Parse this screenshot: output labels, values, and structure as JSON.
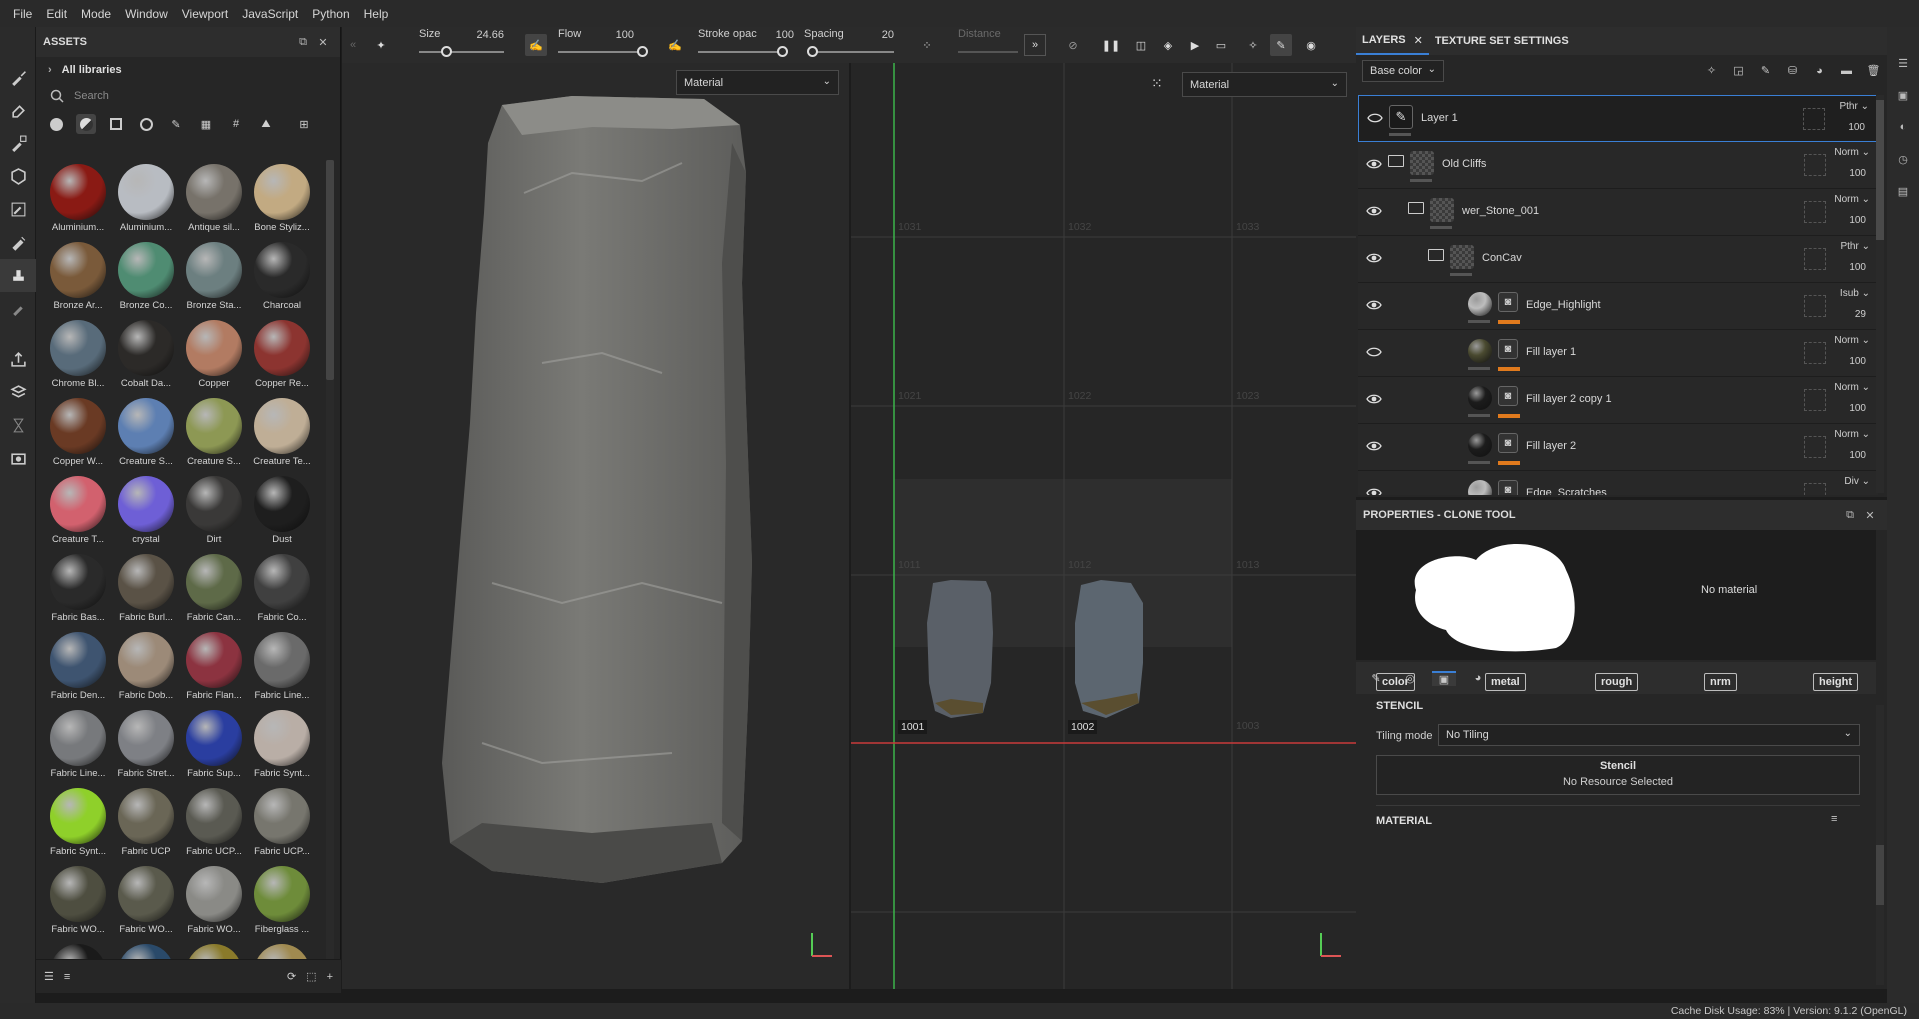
{
  "menu": [
    "File",
    "Edit",
    "Mode",
    "Window",
    "Viewport",
    "JavaScript",
    "Python",
    "Help"
  ],
  "assets": {
    "title": "ASSETS",
    "libraries": "All libraries",
    "search_placeholder": "Search",
    "materials": [
      {
        "label": "Aluminium...",
        "color": "#8a1a14"
      },
      {
        "label": "Aluminium...",
        "color": "#b8bcc2"
      },
      {
        "label": "Antique sil...",
        "color": "#77726a"
      },
      {
        "label": "Bone Styliz...",
        "color": "#c2aa82"
      },
      {
        "label": "Bronze Ar...",
        "color": "#7a5a3a"
      },
      {
        "label": "Bronze Co...",
        "color": "#4f8c72"
      },
      {
        "label": "Bronze Sta...",
        "color": "#6c7f80"
      },
      {
        "label": "Charcoal",
        "color": "#2a2a2a"
      },
      {
        "label": "Chrome Bl...",
        "color": "#586b7a"
      },
      {
        "label": "Cobalt Da...",
        "color": "#2c2a28"
      },
      {
        "label": "Copper",
        "color": "#b27b62"
      },
      {
        "label": "Copper Re...",
        "color": "#8c3430"
      },
      {
        "label": "Copper W...",
        "color": "#6a3a24"
      },
      {
        "label": "Creature S...",
        "color": "#5d7fb2"
      },
      {
        "label": "Creature S...",
        "color": "#8d9854"
      },
      {
        "label": "Creature Te...",
        "color": "#bfae96"
      },
      {
        "label": "Creature T...",
        "color": "#d2616e"
      },
      {
        "label": "crystal",
        "color": "#6e5fd6"
      },
      {
        "label": "Dirt",
        "color": "#3a3938"
      },
      {
        "label": "Dust",
        "color": "#1e1e1e"
      },
      {
        "label": "Fabric Bas...",
        "color": "#2a2a2a"
      },
      {
        "label": "Fabric Burl...",
        "color": "#5a5246"
      },
      {
        "label": "Fabric Can...",
        "color": "#5e6a48"
      },
      {
        "label": "Fabric Co...",
        "color": "#404040"
      },
      {
        "label": "Fabric Den...",
        "color": "#3e5470"
      },
      {
        "label": "Fabric Dob...",
        "color": "#9c8a78"
      },
      {
        "label": "Fabric Flan...",
        "color": "#8c3340"
      },
      {
        "label": "Fabric Line...",
        "color": "#6a6a6a"
      },
      {
        "label": "Fabric Line...",
        "color": "#77797c"
      },
      {
        "label": "Fabric Stret...",
        "color": "#7e8085"
      },
      {
        "label": "Fabric Sup...",
        "color": "#2a3ea0"
      },
      {
        "label": "Fabric Synt...",
        "color": "#b9aea6"
      },
      {
        "label": "Fabric Synt...",
        "color": "#8fd02a"
      },
      {
        "label": "Fabric UCP",
        "color": "#6a6656"
      },
      {
        "label": "Fabric UCP...",
        "color": "#5a5a52"
      },
      {
        "label": "Fabric UCP...",
        "color": "#77766e"
      },
      {
        "label": "Fabric WO...",
        "color": "#4e4e40"
      },
      {
        "label": "Fabric WO...",
        "color": "#5a5a4c"
      },
      {
        "label": "Fabric WO...",
        "color": "#8a8a86"
      },
      {
        "label": "Fiberglass ...",
        "color": "#6e8c3a"
      },
      {
        "label": "",
        "color": "#1a1a1a"
      },
      {
        "label": "",
        "color": "#2a4a6a"
      },
      {
        "label": "",
        "color": "#8a7a2a"
      },
      {
        "label": "",
        "color": "#a08a50"
      }
    ]
  },
  "toolbar": {
    "size_label": "Size",
    "size_value": "24.66",
    "flow_label": "Flow",
    "flow_value": "100",
    "stroke_label": "Stroke opac",
    "stroke_value": "100",
    "spacing_label": "Spacing",
    "spacing_value": "20",
    "distance_label": "Distance",
    "size_frac": 0.32,
    "flow_frac": 1.0,
    "stroke_frac": 1.0,
    "spacing_frac": 0.02
  },
  "viewport3d": {
    "mode": "Material"
  },
  "viewport2d": {
    "mode": "Material",
    "tiles": [
      "1031",
      "1032",
      "1033",
      "1021",
      "1022",
      "1023",
      "1011",
      "1012",
      "1013",
      "1001",
      "1002",
      "1003"
    ]
  },
  "layers": {
    "tab1": "LAYERS",
    "tab2": "TEXTURE SET SETTINGS",
    "channel": "Base color",
    "rows": [
      {
        "name": "Layer 1",
        "blend": "Pthr",
        "opacity": "100"
      },
      {
        "name": "Old Cliffs",
        "blend": "Norm",
        "opacity": "100"
      },
      {
        "name": "wer_Stone_001",
        "blend": "Norm",
        "opacity": "100"
      },
      {
        "name": "ConCav",
        "blend": "Pthr",
        "opacity": "100"
      },
      {
        "name": "Edge_Highlight",
        "blend": "Isub",
        "opacity": "29"
      },
      {
        "name": "Fill layer 1",
        "blend": "Norm",
        "opacity": "100"
      },
      {
        "name": "Fill layer 2 copy 1",
        "blend": "Norm",
        "opacity": "100"
      },
      {
        "name": "Fill layer 2",
        "blend": "Norm",
        "opacity": "100"
      },
      {
        "name": "Edge_Scratches",
        "blend": "Div",
        "opacity": ""
      }
    ]
  },
  "properties": {
    "title": "PROPERTIES - CLONE TOOL",
    "no_material": "No material",
    "stencil_section": "STENCIL",
    "tiling_label": "Tiling mode",
    "tiling_value": "No Tiling",
    "stencil_title": "Stencil",
    "stencil_sub": "No Resource Selected",
    "material_section": "MATERIAL",
    "channels": [
      "color",
      "metal",
      "rough",
      "nrm",
      "height"
    ]
  },
  "status": "Cache Disk Usage:   83% | Version: 9.1.2 (OpenGL)"
}
